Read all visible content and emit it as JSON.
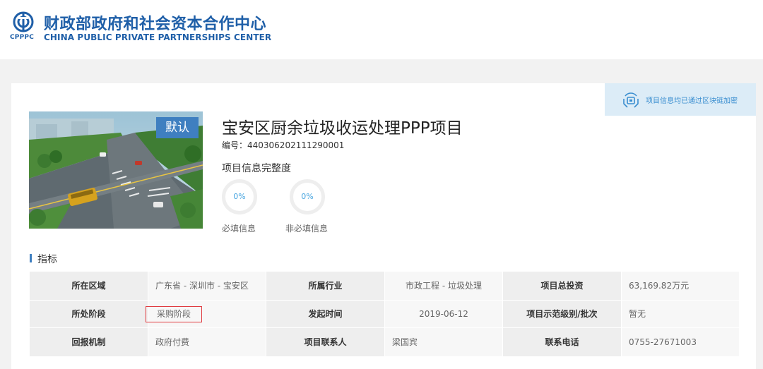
{
  "header": {
    "org_abbr": "CPPPC",
    "org_name_cn": "财政部政府和社会资本合作中心",
    "org_name_en": "CHINA PUBLIC PRIVATE PARTNERSHIPS CENTER"
  },
  "chain_badge": {
    "text": "项目信息均已通过区块链加密"
  },
  "project": {
    "image_tag": "默认",
    "title": "宝安区厨余垃圾收运处理PPP项目",
    "code": "编号：440306202111290001"
  },
  "completeness": {
    "title": "项目信息完整度",
    "required": {
      "label": "必填信息",
      "value": "0%",
      "fraction": 0
    },
    "optional": {
      "label": "非必填信息",
      "value": "0%",
      "fraction": 0
    }
  },
  "indicators": {
    "title": "指标",
    "rows": [
      [
        {
          "label": "所在区域",
          "value": "广东省 - 深圳市 - 宝安区"
        },
        {
          "label": "所属行业",
          "value": "市政工程 - 垃圾处理"
        },
        {
          "label": "项目总投资",
          "value": "63,169.82万元"
        }
      ],
      [
        {
          "label": "所处阶段",
          "value": "采购阶段"
        },
        {
          "label": "发起时间",
          "value": "2019-06-12"
        },
        {
          "label": "项目示范级别/批次",
          "value": "暂无"
        }
      ],
      [
        {
          "label": "回报机制",
          "value": "政府付费"
        },
        {
          "label": "项目联系人",
          "value": "梁国宾"
        },
        {
          "label": "联系电话",
          "value": "0755-27671003"
        }
      ]
    ]
  },
  "colors": {
    "brand_blue": "#1f5fa8",
    "accent_blue": "#3f7fc0",
    "highlight_red": "#e0393e",
    "badge_bg": "#dcecf7"
  }
}
